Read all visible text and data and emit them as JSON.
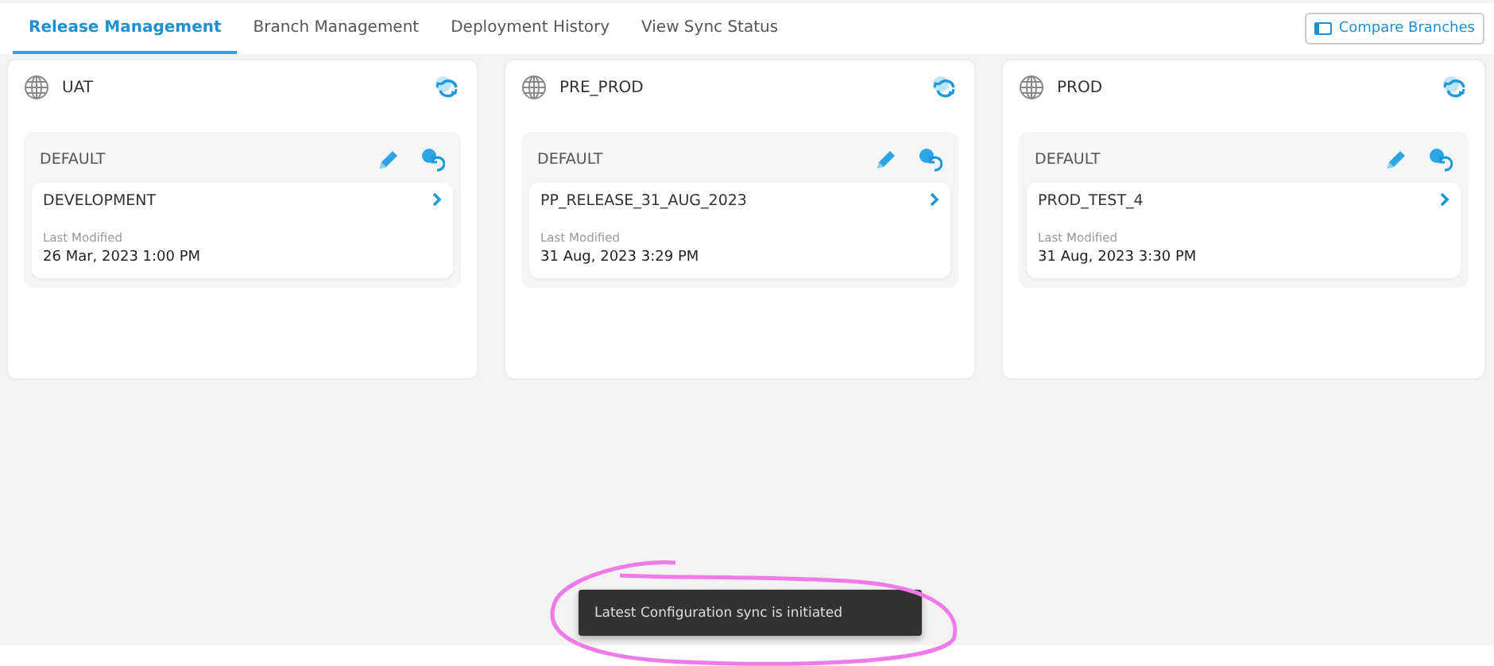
{
  "tabs": [
    {
      "label": "Release Management",
      "selected": true
    },
    {
      "label": "Branch Management",
      "selected": false
    },
    {
      "label": "Deployment History",
      "selected": false
    },
    {
      "label": "View Sync Status",
      "selected": false
    }
  ],
  "compare_button": {
    "label": "Compare Branches"
  },
  "environments": [
    {
      "name": "UAT",
      "group": "DEFAULT",
      "branch": "DEVELOPMENT",
      "modified_label": "Last Modified",
      "modified": "26 Mar, 2023 1:00 PM"
    },
    {
      "name": "PRE_PROD",
      "group": "DEFAULT",
      "branch": "PP_RELEASE_31_AUG_2023",
      "modified_label": "Last Modified",
      "modified": "31 Aug, 2023 3:29 PM"
    },
    {
      "name": "PROD",
      "group": "DEFAULT",
      "branch": "PROD_TEST_4",
      "modified_label": "Last Modified",
      "modified": "31 Aug, 2023 3:30 PM"
    }
  ],
  "toast": {
    "message": "Latest Configuration sync is initiated"
  }
}
